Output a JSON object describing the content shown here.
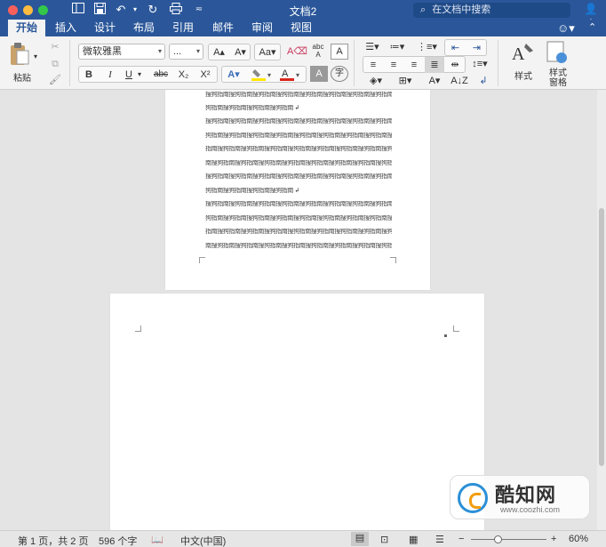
{
  "titlebar": {
    "title": "文档2",
    "search_placeholder": "在文档中搜索"
  },
  "tabs": [
    {
      "label": "开始",
      "active": true
    },
    {
      "label": "插入"
    },
    {
      "label": "设计"
    },
    {
      "label": "布局"
    },
    {
      "label": "引用"
    },
    {
      "label": "邮件"
    },
    {
      "label": "审阅"
    },
    {
      "label": "视图"
    }
  ],
  "ribbon": {
    "paste_label": "粘贴",
    "font_name": "微软雅黑",
    "font_size": "...",
    "bold": "B",
    "italic": "I",
    "underline": "U",
    "strikethrough": "abc",
    "subscript": "X₂",
    "superscript": "X²",
    "styles_label": "样式",
    "styles_pane_label": "样式\n窗格",
    "font_color": "#d9261c",
    "highlight_color": "#ffe600",
    "accent_color": "#2b579a"
  },
  "document": {
    "lines": [
      "搜狗指南搜狗指南搜狗指南搜狗指南搜狗指南搜狗指南搜狗指南搜狗指南搜狗",
      "狗指南搜狗指南搜狗指南搜狗指南 ↲",
      "搜狗指南搜狗指南搜狗指南搜狗指南搜狗指南搜狗指南搜狗指南搜狗指南搜",
      "狗指南搜狗指南搜狗指南搜狗指南搜狗指南搜狗指南搜狗指南搜狗指南搜狗",
      "指南搜狗指南搜狗指南搜狗指南搜狗指南搜狗指南搜狗指南搜狗指南搜狗指",
      "南搜狗指南搜狗指南搜狗指南搜狗指南搜狗指南搜狗指南搜狗指南搜狗指南",
      "搜狗指南搜狗指南搜狗指南搜狗指南搜狗指南搜狗指南搜狗指南搜狗指南搜",
      "狗指南搜狗指南搜狗指南搜狗指南 ↲",
      "搜狗指南搜狗指南搜狗指南搜狗指南搜狗指南搜狗指南搜狗指南搜狗指南搜",
      "狗指南搜狗指南搜狗指南搜狗指南搜狗指南搜狗指南搜狗指南搜狗指南搜狗",
      "指南搜狗指南搜狗指南搜狗指南搜狗指南搜狗指南搜狗指南搜狗指南搜狗指",
      "南搜狗指南搜狗指南搜狗指南搜狗指南搜狗指南搜狗指南搜狗指南搜狗指南 ↲"
    ]
  },
  "watermark": {
    "text": "酷知网",
    "url": "www.coozhi.com"
  },
  "status": {
    "page": "第 1 页，共 2 页",
    "words": "596 个字",
    "language": "中文(中国)",
    "zoom": "60%",
    "zoom_value": 0.6
  }
}
